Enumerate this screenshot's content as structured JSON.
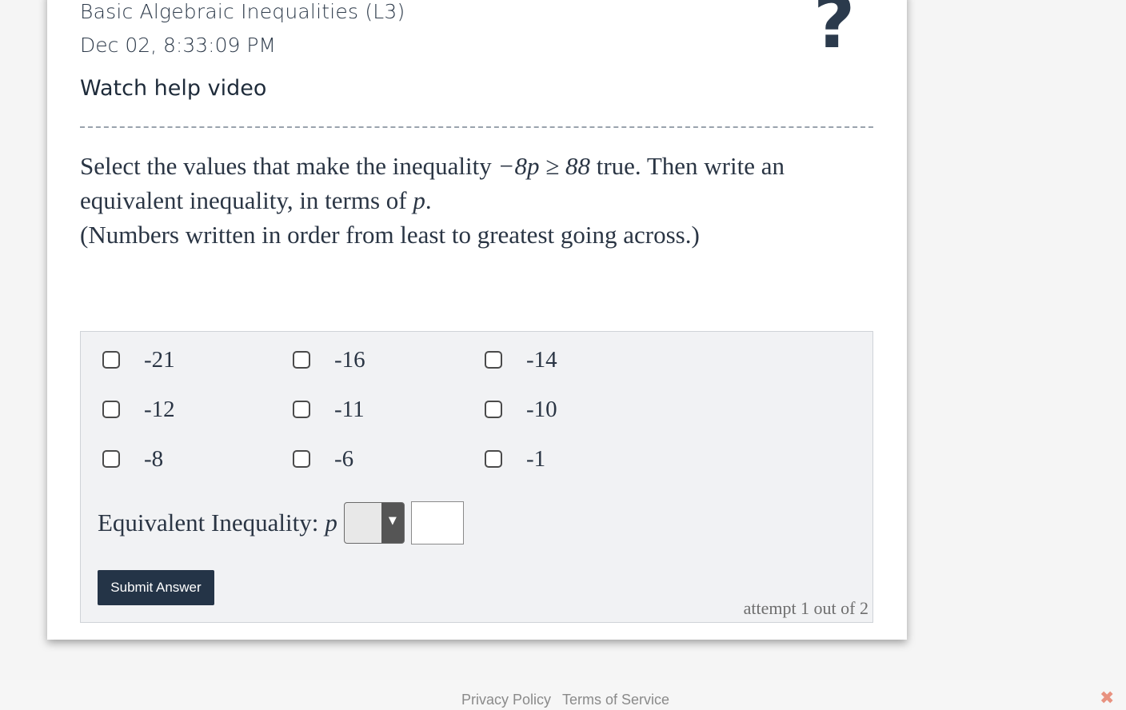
{
  "header": {
    "title": "Basic Algebraic Inequalities (L3)",
    "datetime": "Dec 02, 8:33:09 PM",
    "help_link": "Watch help video",
    "help_icon": "?"
  },
  "question": {
    "line1_before": "Select the values that make the inequality ",
    "inequality": "−8p ≥ 88",
    "line1_after": " true. Then write an",
    "line2_before": "equivalent inequality, in terms of ",
    "variable": "p",
    "line2_after": ".",
    "line3": "(Numbers written in order from least to greatest going across.)"
  },
  "options": [
    {
      "label": "-21"
    },
    {
      "label": "-16"
    },
    {
      "label": "-14"
    },
    {
      "label": "-12"
    },
    {
      "label": "-11"
    },
    {
      "label": "-10"
    },
    {
      "label": "-8"
    },
    {
      "label": "-6"
    },
    {
      "label": "-1"
    }
  ],
  "equivalent": {
    "label": "Equivalent Inequality:",
    "variable": "p",
    "dropdown_value": "",
    "input_value": ""
  },
  "submit_label": "Submit Answer",
  "attempt_text": "attempt 1 out of 2",
  "footer": {
    "privacy": "Privacy Policy",
    "terms": "Terms of Service",
    "close_icon": "✖"
  },
  "icons": {
    "help": "help-icon",
    "dropdown_arrow": "chevron-down-icon",
    "close": "close-icon"
  }
}
